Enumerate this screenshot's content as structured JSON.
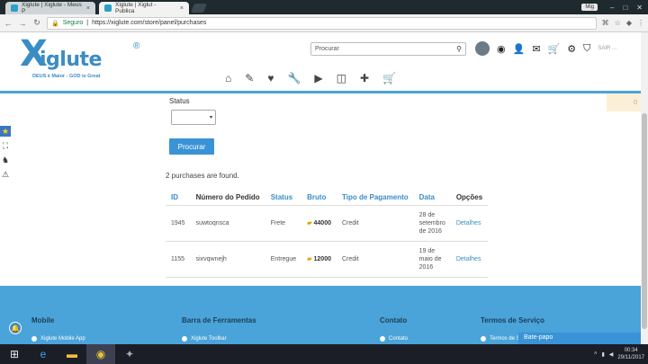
{
  "browser": {
    "tabs": [
      {
        "label": "Xiglute | Xiglute - Meus P",
        "close": "×"
      },
      {
        "label": "Xiglute | Xiglut - Publica",
        "close": "×"
      }
    ],
    "window_user": "Mig",
    "secure_label": "Seguro",
    "url": "https://xiglute.com/store/panel/purchases"
  },
  "site": {
    "logo": {
      "x": "X",
      "name": "iglute",
      "reg": "®",
      "tagline": "DEUS é Maior - GOD is Great"
    },
    "search_placeholder": "Procurar",
    "logout": "SAIR ...",
    "nav_icons": [
      "home-icon",
      "pencil-icon",
      "heart-icon",
      "wrench-icon",
      "play-icon",
      "columns-icon",
      "plus-icon",
      "cart-icon"
    ],
    "notice_count": "0"
  },
  "form": {
    "status_label": "Status",
    "status_value": "",
    "search_button": "Procurar"
  },
  "results": {
    "summary": "2 purchases are found.",
    "columns": [
      "ID",
      "Número do Pedido",
      "Status",
      "Bruto",
      "Tipo de Pagamento",
      "Data",
      "Opções"
    ],
    "rows": [
      {
        "id": "1945",
        "order": "suwtoqnsca",
        "status": "Frete",
        "gross": "44000",
        "payment": "Credit",
        "date": "28 de setembro de 2016",
        "action": "Detalhes"
      },
      {
        "id": "1155",
        "order": "sixvqwnejh",
        "status": "Entregue",
        "gross": "12000",
        "payment": "Credit",
        "date": "19 de maio de 2016",
        "action": "Detalhes"
      }
    ]
  },
  "footer": {
    "columns": [
      {
        "title": "Mobile",
        "item": "Xiglute Mobile App"
      },
      {
        "title": "Barra de Ferramentas",
        "item": "Xiglute Toolbar"
      },
      {
        "title": "Contato",
        "item": "Contato"
      },
      {
        "title": "Termos de Serviço",
        "item": "Termos de S"
      }
    ],
    "chat_label": "Bate-papo"
  },
  "taskbar": {
    "time": "00:34",
    "date": "29/11/2017"
  },
  "colors": {
    "accent": "#3a8cc4",
    "button": "#3a93d6",
    "footer": "#4aa3d9"
  }
}
